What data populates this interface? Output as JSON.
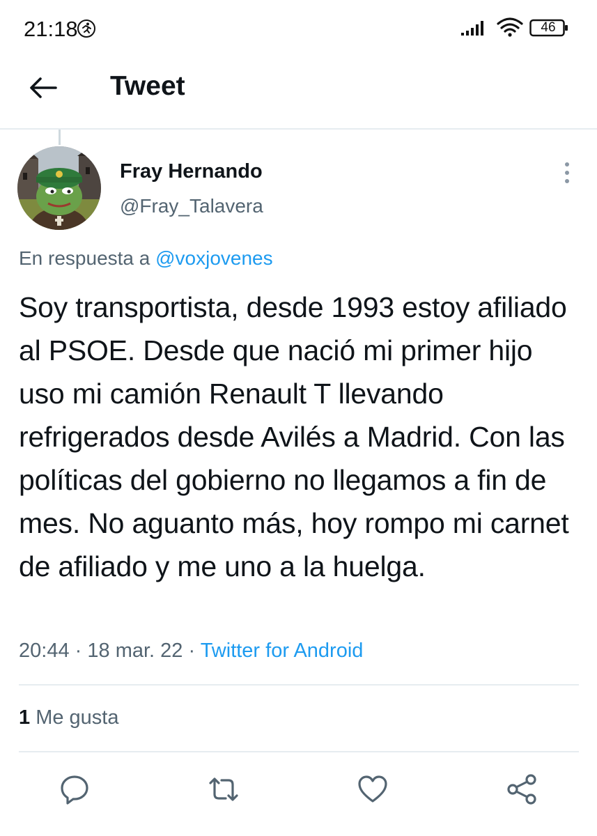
{
  "status_bar": {
    "time": "21:18",
    "battery": "46",
    "icons": [
      "runner-icon",
      "signal-icon",
      "wifi-icon",
      "battery-icon"
    ]
  },
  "header": {
    "title": "Tweet",
    "back_icon": "back-arrow-icon"
  },
  "author": {
    "name": "Fray Hernando",
    "handle": "@Fray_Talavera"
  },
  "reply": {
    "prefix": "En respuesta a",
    "mention": "@voxjovenes"
  },
  "tweet": {
    "text": "Soy transportista, desde 1993 estoy afiliado al PSOE. Desde que nació mi primer hijo uso mi camión Renault T llevando refrigerados desde Avilés a Madrid. Con las políticas del gobierno no llegamos a fin de mes. No aguanto más, hoy rompo mi carnet de afiliado y me uno a la huelga.",
    "time": "20:44",
    "date": "18 mar. 22",
    "source": "Twitter for Android",
    "separator": "·"
  },
  "engagement": {
    "likes_count": "1",
    "likes_label": "Me gusta"
  },
  "actions": [
    "reply-icon",
    "retweet-icon",
    "like-icon",
    "share-icon"
  ],
  "colors": {
    "accent": "#1d9bf0",
    "text": "#0f1419",
    "secondary": "#536471",
    "divider": "#e6ecf0"
  }
}
